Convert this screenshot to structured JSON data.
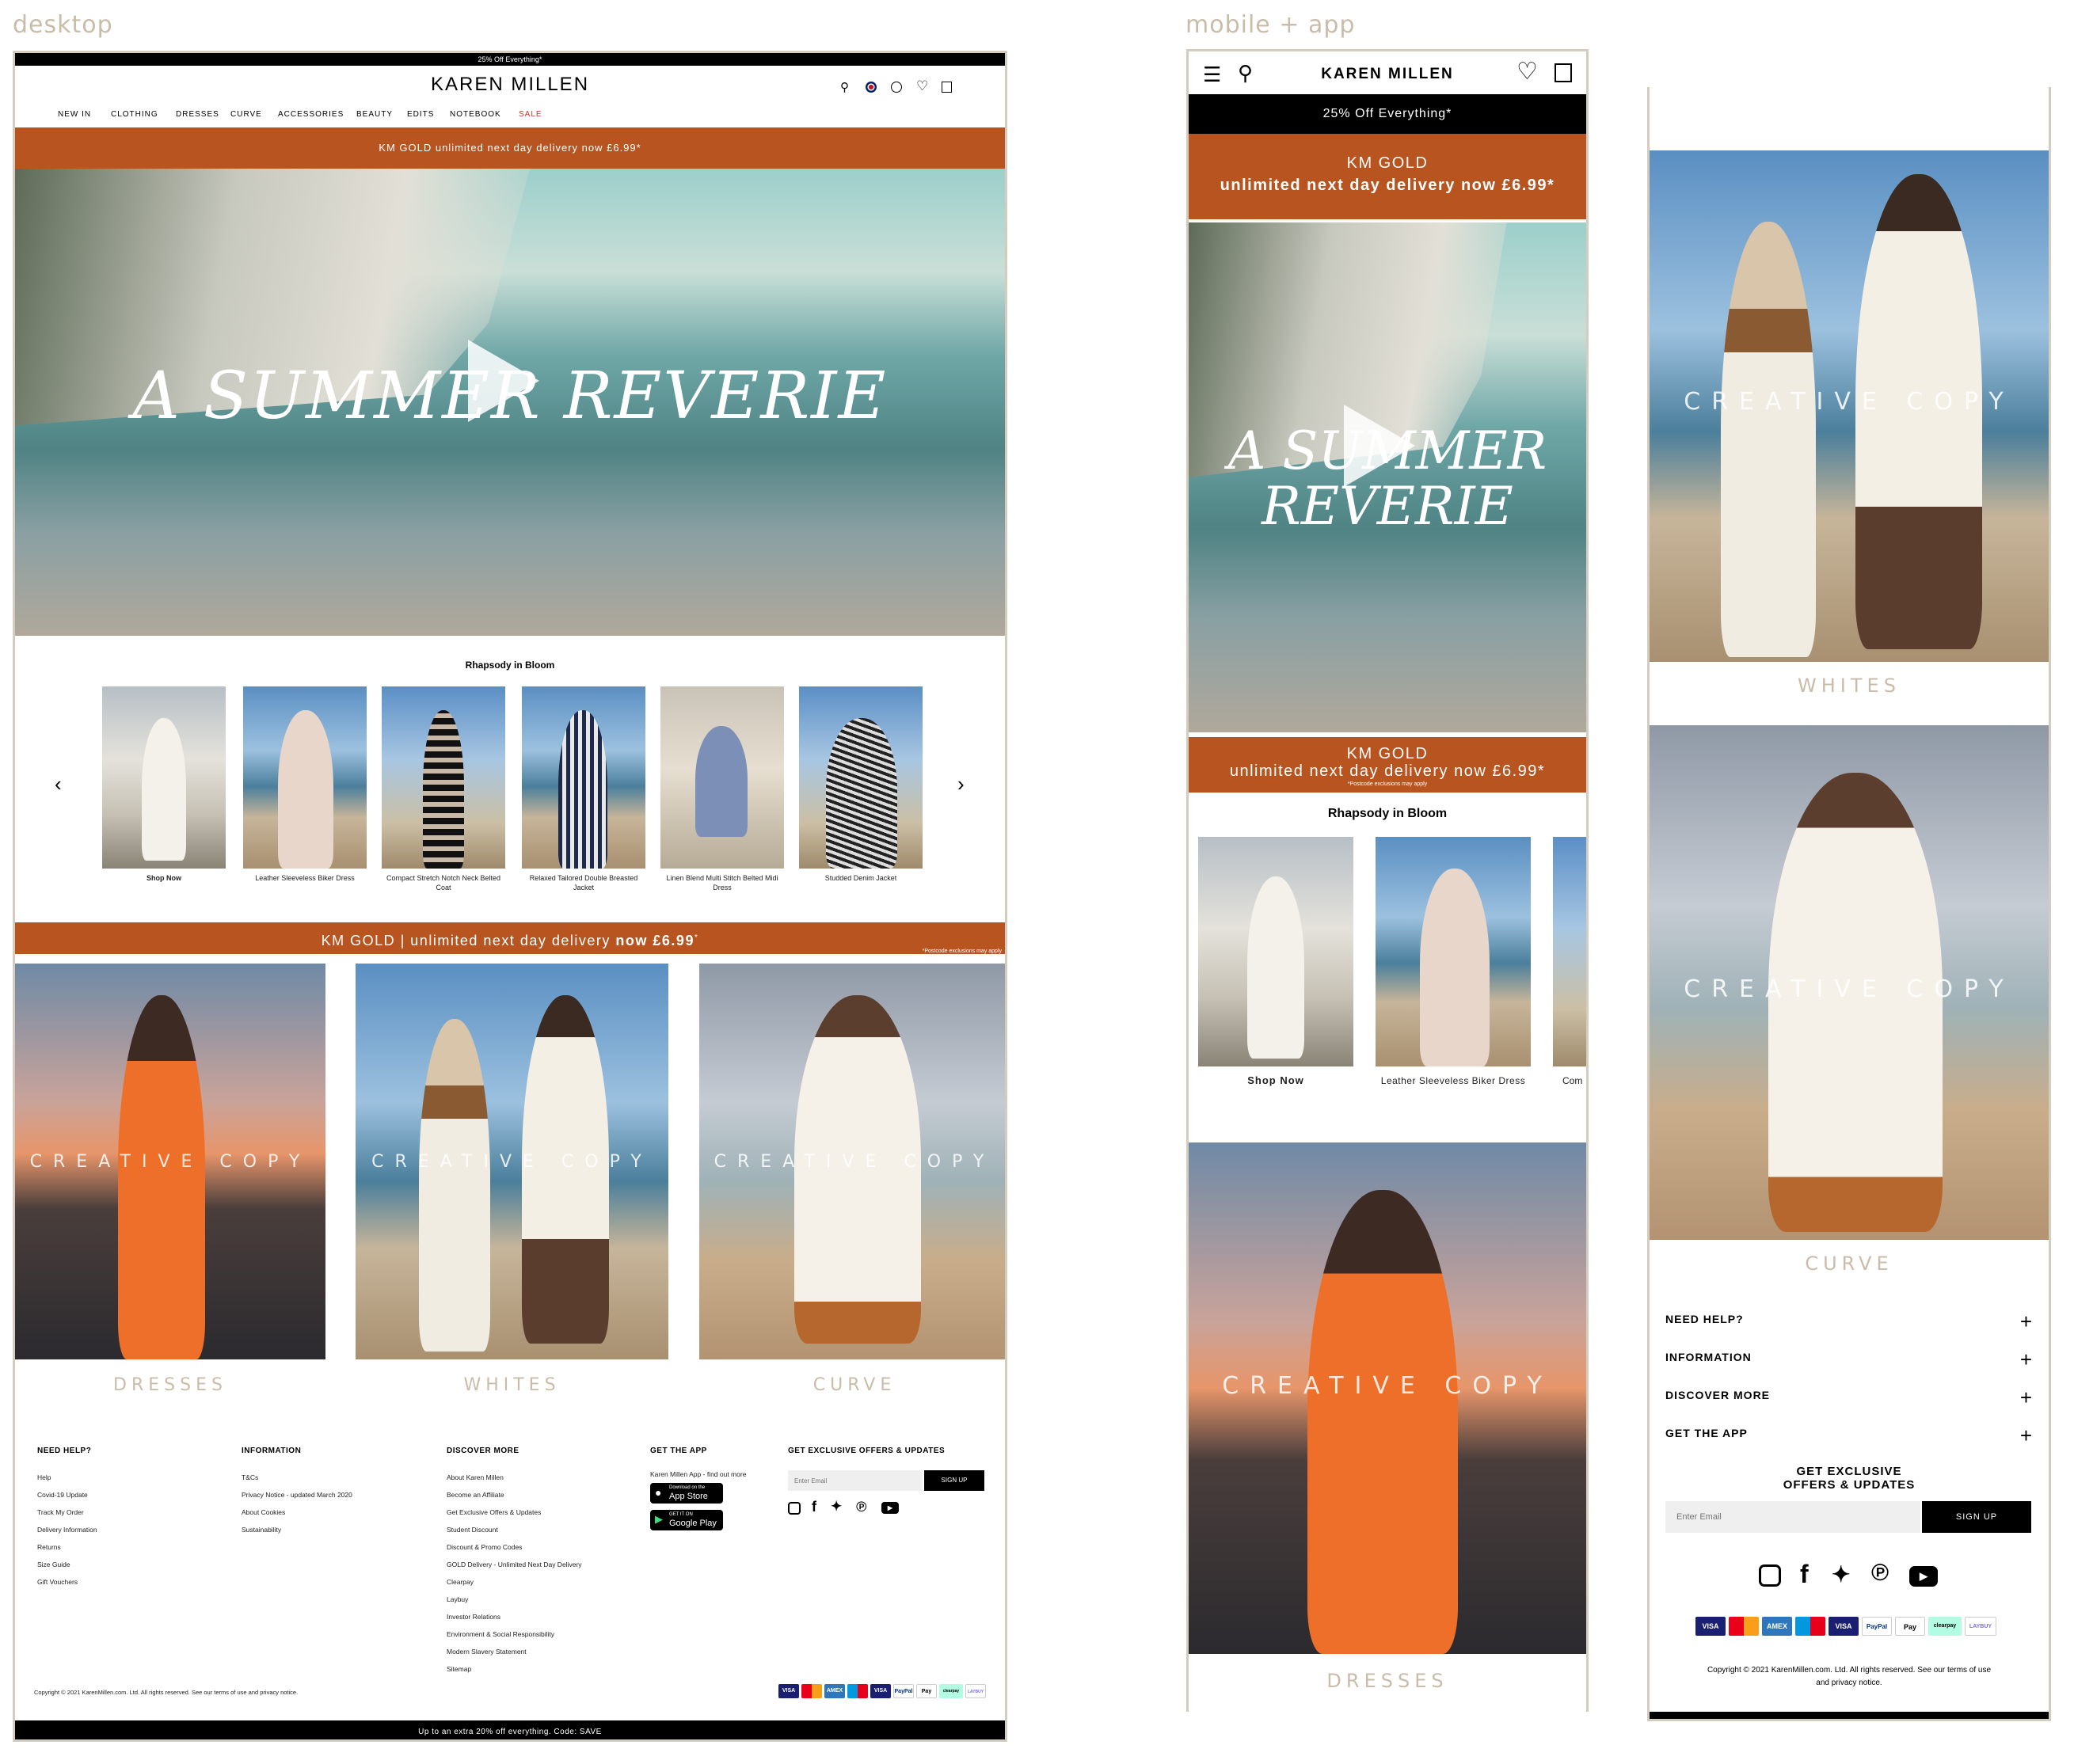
{
  "labels": {
    "desktop": "desktop",
    "mobile": "mobile + app"
  },
  "desktop": {
    "promo_top": "25% Off Everything*",
    "brand": "KAREN MILLEN",
    "nav": [
      "NEW IN",
      "CLOTHING",
      "DRESSES",
      "CURVE",
      "ACCESSORIES",
      "BEAUTY",
      "EDITS",
      "NOTEBOOK",
      "SALE"
    ],
    "gold_banner": "KM GOLD unlimited next day delivery now £6.99*",
    "hero_title": "A SUMMER REVERIE",
    "section_title": "Rhapsody in Bloom",
    "products": [
      {
        "caption": "Shop Now"
      },
      {
        "caption": "Leather Sleeveless Biker Dress"
      },
      {
        "caption": "Compact Stretch Notch Neck Belted Coat"
      },
      {
        "caption": "Relaxed Tailored Double Breasted Jacket"
      },
      {
        "caption": "Linen Blend Multi Stitch Belted Midi Dress"
      },
      {
        "caption": "Studded Denim Jacket"
      }
    ],
    "gold_strip": {
      "left": "KM GOLD | unlimited next day delivery ",
      "bold": "now £6.99",
      "sup": "*",
      "note": "*Postcode exclusions may apply"
    },
    "creative_copy": "CREATIVE COPY",
    "categories": [
      "DRESSES",
      "WHITES",
      "CURVE"
    ],
    "footer": {
      "need_help": {
        "title": "NEED HELP?",
        "links": [
          "Help",
          "Covid-19 Update",
          "Track My Order",
          "Delivery Information",
          "Returns",
          "Size Guide",
          "Gift Vouchers"
        ]
      },
      "information": {
        "title": "INFORMATION",
        "links": [
          "T&Cs",
          "Privacy Notice - updated March 2020",
          "About Cookies",
          "Sustainability"
        ]
      },
      "discover": {
        "title": "DISCOVER MORE",
        "links": [
          "About Karen Millen",
          "Become an Affiliate",
          "Get Exclusive Offers & Updates",
          "Student Discount",
          "Discount & Promo Codes",
          "GOLD Delivery - Unlimited Next Day Delivery",
          "Clearpay",
          "Laybuy",
          "Investor Relations",
          "Environment & Social Responsibility",
          "Modern Slavery Statement",
          "Sitemap"
        ]
      },
      "app": {
        "title": "GET THE APP",
        "text": "Karen Millen App - find out more",
        "app_store_small": "Download on the",
        "app_store": "App Store",
        "google_small": "GET IT ON",
        "google": "Google Play"
      },
      "offers": {
        "title": "GET EXCLUSIVE OFFERS & UPDATES",
        "placeholder": "Enter Email",
        "button": "SIGN UP"
      },
      "copyright": "Copyright © 2021 KarenMillen.com. Ltd. All rights reserved. See our terms of use and privacy notice.",
      "bottom_bar": "Up to an extra 20% off everything. Code: SAVE"
    }
  },
  "mobile": {
    "brand": "KAREN MILLEN",
    "promo": "25% Off Everything*",
    "gold_title": "KM GOLD",
    "gold_sub": "unlimited next day delivery now £6.99*",
    "hero_line1": "A SUMMER",
    "hero_line2": "REVERIE",
    "strip_title": "KM GOLD",
    "strip_sub": "unlimited next day delivery now £6.99*",
    "strip_note": "*Postcode exclusions may apply",
    "section_title": "Rhapsody in Bloom",
    "products": [
      {
        "caption": "Shop Now"
      },
      {
        "caption": "Leather Sleeveless Biker Dress"
      },
      {
        "caption": "Com"
      }
    ],
    "creative_copy": "CREATIVE COPY",
    "cat1": "DRESSES"
  },
  "app": {
    "creative_copy": "CREATIVE COPY",
    "cat_whites": "WHITES",
    "cat_curve": "CURVE",
    "accordion": [
      "NEED HELP?",
      "INFORMATION",
      "DISCOVER MORE",
      "GET THE APP"
    ],
    "offers_title_1": "GET EXCLUSIVE",
    "offers_title_2": "OFFERS & UPDATES",
    "placeholder": "Enter Email",
    "button": "SIGN UP",
    "copyright_1": "Copyright © 2021 KarenMillen.com. Ltd. All rights reserved. See our terms of use",
    "copyright_2": "and privacy notice."
  },
  "payments": [
    "VISA",
    "mastercard",
    "AMEX",
    "maestro",
    "VISA",
    "PayPal",
    "Pay",
    "clearpay",
    "LAYBUY"
  ],
  "colors": {
    "accent_orange": "#b8541f",
    "label_beige": "#c9bca9",
    "frame": "#d4ccbf",
    "sale_red": "#c0392b"
  }
}
